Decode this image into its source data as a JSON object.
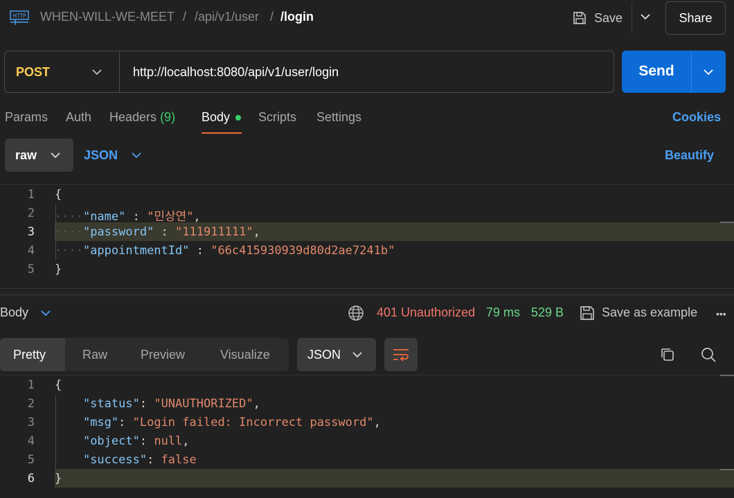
{
  "header": {
    "breadcrumb": [
      "WHEN-WILL-WE-MEET",
      "/api/v1/user",
      "/login"
    ],
    "separators": [
      "/",
      "/"
    ],
    "save_label": "Save",
    "share_label": "Share",
    "app_icon": "http-icon"
  },
  "request": {
    "method": "POST",
    "url": "http://localhost:8080/api/v1/user/login",
    "send_label": "Send"
  },
  "tabs": {
    "params": "Params",
    "auth": "Auth",
    "headers": "Headers",
    "headers_count": "(9)",
    "body": "Body",
    "scripts": "Scripts",
    "settings": "Settings",
    "cookies": "Cookies",
    "active": "Body"
  },
  "body_options": {
    "mode": "raw",
    "language": "JSON",
    "beautify": "Beautify"
  },
  "request_body": {
    "line_numbers": [
      "1",
      "2",
      "3",
      "4",
      "5"
    ],
    "current_line": 3,
    "open": "{",
    "close": "}",
    "fields": [
      {
        "key": "\"name\"",
        "sep": " : ",
        "value": "\"민상연\"",
        "trail": ","
      },
      {
        "key": "\"password\"",
        "sep": " : ",
        "value": "\"111911111\"",
        "trail": ","
      },
      {
        "key": "\"appointmentId\"",
        "sep": " : ",
        "value": "\"66c415930939d80d2ae7241b\"",
        "trail": ""
      }
    ]
  },
  "response_bar": {
    "label": "Body",
    "status": "401 Unauthorized",
    "time": "79 ms",
    "size": "529 B",
    "save_example": "Save as example",
    "more": "•••"
  },
  "response_view": {
    "tabs": [
      "Pretty",
      "Raw",
      "Preview",
      "Visualize"
    ],
    "active": "Pretty",
    "format": "JSON"
  },
  "response_body": {
    "line_numbers": [
      "1",
      "2",
      "3",
      "4",
      "5",
      "6"
    ],
    "current_line": 6,
    "open": "{",
    "close": "}",
    "fields": [
      {
        "key": "\"status\"",
        "sep": ": ",
        "value": "\"UNAUTHORIZED\"",
        "trail": ",",
        "kind": "str"
      },
      {
        "key": "\"msg\"",
        "sep": ": ",
        "value": "\"Login failed: Incorrect password\"",
        "trail": ",",
        "kind": "str"
      },
      {
        "key": "\"object\"",
        "sep": ": ",
        "value": "null",
        "trail": ",",
        "kind": "kw"
      },
      {
        "key": "\"success\"",
        "sep": ": ",
        "value": "false",
        "trail": "",
        "kind": "kw"
      }
    ]
  },
  "colors": {
    "send": "#0c6bd6",
    "method": "#ffcc55",
    "status_error": "#f1766b",
    "ok_green": "#6cd68a",
    "tab_underline": "#f26b3a",
    "link": "#4aa0f5"
  }
}
